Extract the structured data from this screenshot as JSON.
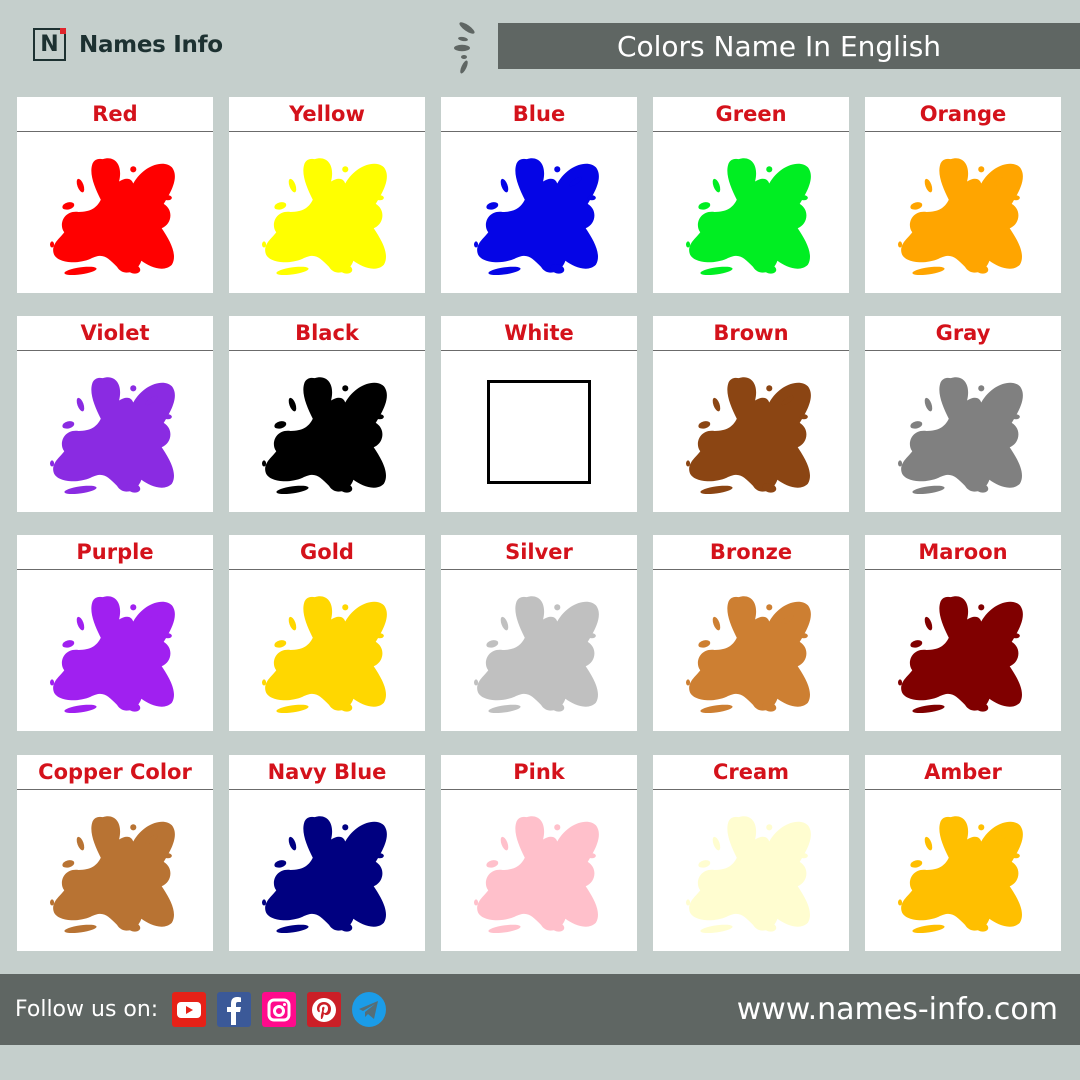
{
  "brand": {
    "logo_letter": "N",
    "name": "Names Info"
  },
  "header": {
    "title": "Colors Name In English"
  },
  "colors": [
    {
      "name": "Red",
      "hex": "#ff0000"
    },
    {
      "name": "Yellow",
      "hex": "#ffff00"
    },
    {
      "name": "Blue",
      "hex": "#0505e6"
    },
    {
      "name": "Green",
      "hex": "#00ee22"
    },
    {
      "name": "Orange",
      "hex": "#ffa500"
    },
    {
      "name": "Violet",
      "hex": "#8a2be2"
    },
    {
      "name": "Black",
      "hex": "#000000"
    },
    {
      "name": "White",
      "hex": "#ffffff"
    },
    {
      "name": "Brown",
      "hex": "#8b4513"
    },
    {
      "name": "Gray",
      "hex": "#808080"
    },
    {
      "name": "Purple",
      "hex": "#a020f0"
    },
    {
      "name": "Gold",
      "hex": "#ffd700"
    },
    {
      "name": "Silver",
      "hex": "#c0c0c0"
    },
    {
      "name": "Bronze",
      "hex": "#cd7f32"
    },
    {
      "name": "Maroon",
      "hex": "#800000"
    },
    {
      "name": "Copper Color",
      "hex": "#b87333"
    },
    {
      "name": "Navy Blue",
      "hex": "#000080"
    },
    {
      "name": "Pink",
      "hex": "#ffc0cb"
    },
    {
      "name": "Cream",
      "hex": "#fffdd0"
    },
    {
      "name": "Amber",
      "hex": "#ffbf00"
    }
  ],
  "footer": {
    "follow_label": "Follow us on:",
    "social": [
      {
        "name": "youtube",
        "icon": "youtube-icon",
        "color": "#e62117"
      },
      {
        "name": "facebook",
        "icon": "facebook-icon",
        "color": "#3b5998"
      },
      {
        "name": "instagram",
        "icon": "instagram-icon",
        "color": "#ff0a8c"
      },
      {
        "name": "pinterest",
        "icon": "pinterest-icon",
        "color": "#cb1f27"
      },
      {
        "name": "telegram",
        "icon": "telegram-icon",
        "color": "#1b9ce8"
      }
    ],
    "url": "www.names-info.com"
  }
}
